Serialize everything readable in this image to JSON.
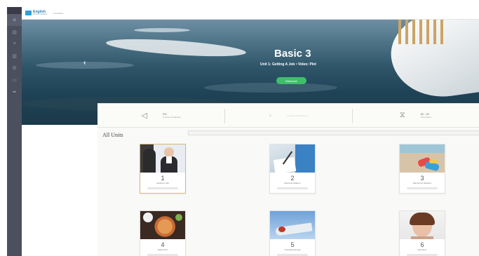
{
  "header": {
    "logo_text": "English",
    "logo_sub": "DISCOVERIES",
    "crumb": "Units Basic"
  },
  "sidebar": {
    "items": [
      {
        "icon": "home-icon",
        "glyph": "⌂",
        "active": true
      },
      {
        "icon": "book-icon",
        "glyph": "▤",
        "active": false
      },
      {
        "icon": "list-icon",
        "glyph": "≡",
        "active": false
      },
      {
        "icon": "document-icon",
        "glyph": "▥",
        "active": false
      },
      {
        "icon": "settings-icon",
        "glyph": "⚙",
        "active": false
      },
      {
        "icon": "chat-icon",
        "glyph": "▭",
        "active": false
      },
      {
        "icon": "share-icon",
        "glyph": "➦",
        "active": false
      }
    ]
  },
  "hero": {
    "title": "Basic 3",
    "subtitle": "Unit 1: Getting A Job • Video: Plot",
    "button": "Welcome"
  },
  "stats": [
    {
      "icon": "megaphone-icon",
      "value": "0%",
      "label": "Course Completion",
      "light": false
    },
    {
      "icon": "chart-icon",
      "value": "",
      "label": "Average Mini Quizzes",
      "light": true
    },
    {
      "icon": "hourglass-icon",
      "value": "00 : 00",
      "label": "Time Spent",
      "light": false
    }
  ],
  "units": {
    "heading": "All Units",
    "cards": [
      {
        "number": "1",
        "name": "Getting A Job",
        "selected": true,
        "thumb": "t1"
      },
      {
        "number": "2",
        "name": "Business Matters",
        "selected": false,
        "thumb": "t2"
      },
      {
        "number": "3",
        "name": "Planning A Vacation",
        "selected": false,
        "thumb": "t3"
      },
      {
        "number": "4",
        "name": "Eating Out",
        "selected": false,
        "thumb": "t4"
      },
      {
        "number": "5",
        "name": "Traveling Abroad",
        "selected": false,
        "thumb": "t5"
      },
      {
        "number": "6",
        "name": "Emotions",
        "selected": false,
        "thumb": "t6"
      }
    ]
  }
}
